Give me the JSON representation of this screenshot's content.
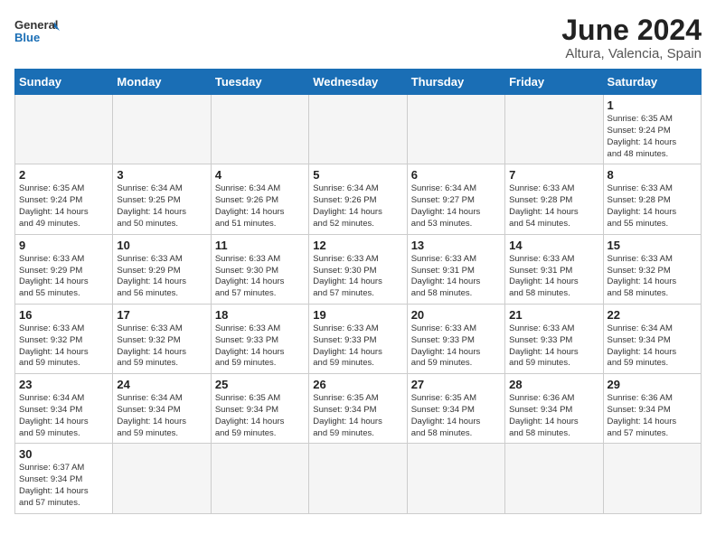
{
  "header": {
    "logo_general": "General",
    "logo_blue": "Blue",
    "month_title": "June 2024",
    "location": "Altura, Valencia, Spain"
  },
  "weekdays": [
    "Sunday",
    "Monday",
    "Tuesday",
    "Wednesday",
    "Thursday",
    "Friday",
    "Saturday"
  ],
  "days": {
    "d1": {
      "num": "1",
      "info": "Sunrise: 6:35 AM\nSunset: 9:24 PM\nDaylight: 14 hours\nand 48 minutes."
    },
    "d2": {
      "num": "2",
      "info": "Sunrise: 6:35 AM\nSunset: 9:24 PM\nDaylight: 14 hours\nand 49 minutes."
    },
    "d3": {
      "num": "3",
      "info": "Sunrise: 6:34 AM\nSunset: 9:25 PM\nDaylight: 14 hours\nand 50 minutes."
    },
    "d4": {
      "num": "4",
      "info": "Sunrise: 6:34 AM\nSunset: 9:26 PM\nDaylight: 14 hours\nand 51 minutes."
    },
    "d5": {
      "num": "5",
      "info": "Sunrise: 6:34 AM\nSunset: 9:26 PM\nDaylight: 14 hours\nand 52 minutes."
    },
    "d6": {
      "num": "6",
      "info": "Sunrise: 6:34 AM\nSunset: 9:27 PM\nDaylight: 14 hours\nand 53 minutes."
    },
    "d7": {
      "num": "7",
      "info": "Sunrise: 6:33 AM\nSunset: 9:28 PM\nDaylight: 14 hours\nand 54 minutes."
    },
    "d8": {
      "num": "8",
      "info": "Sunrise: 6:33 AM\nSunset: 9:28 PM\nDaylight: 14 hours\nand 55 minutes."
    },
    "d9": {
      "num": "9",
      "info": "Sunrise: 6:33 AM\nSunset: 9:29 PM\nDaylight: 14 hours\nand 55 minutes."
    },
    "d10": {
      "num": "10",
      "info": "Sunrise: 6:33 AM\nSunset: 9:29 PM\nDaylight: 14 hours\nand 56 minutes."
    },
    "d11": {
      "num": "11",
      "info": "Sunrise: 6:33 AM\nSunset: 9:30 PM\nDaylight: 14 hours\nand 57 minutes."
    },
    "d12": {
      "num": "12",
      "info": "Sunrise: 6:33 AM\nSunset: 9:30 PM\nDaylight: 14 hours\nand 57 minutes."
    },
    "d13": {
      "num": "13",
      "info": "Sunrise: 6:33 AM\nSunset: 9:31 PM\nDaylight: 14 hours\nand 58 minutes."
    },
    "d14": {
      "num": "14",
      "info": "Sunrise: 6:33 AM\nSunset: 9:31 PM\nDaylight: 14 hours\nand 58 minutes."
    },
    "d15": {
      "num": "15",
      "info": "Sunrise: 6:33 AM\nSunset: 9:32 PM\nDaylight: 14 hours\nand 58 minutes."
    },
    "d16": {
      "num": "16",
      "info": "Sunrise: 6:33 AM\nSunset: 9:32 PM\nDaylight: 14 hours\nand 59 minutes."
    },
    "d17": {
      "num": "17",
      "info": "Sunrise: 6:33 AM\nSunset: 9:32 PM\nDaylight: 14 hours\nand 59 minutes."
    },
    "d18": {
      "num": "18",
      "info": "Sunrise: 6:33 AM\nSunset: 9:33 PM\nDaylight: 14 hours\nand 59 minutes."
    },
    "d19": {
      "num": "19",
      "info": "Sunrise: 6:33 AM\nSunset: 9:33 PM\nDaylight: 14 hours\nand 59 minutes."
    },
    "d20": {
      "num": "20",
      "info": "Sunrise: 6:33 AM\nSunset: 9:33 PM\nDaylight: 14 hours\nand 59 minutes."
    },
    "d21": {
      "num": "21",
      "info": "Sunrise: 6:33 AM\nSunset: 9:33 PM\nDaylight: 14 hours\nand 59 minutes."
    },
    "d22": {
      "num": "22",
      "info": "Sunrise: 6:34 AM\nSunset: 9:34 PM\nDaylight: 14 hours\nand 59 minutes."
    },
    "d23": {
      "num": "23",
      "info": "Sunrise: 6:34 AM\nSunset: 9:34 PM\nDaylight: 14 hours\nand 59 minutes."
    },
    "d24": {
      "num": "24",
      "info": "Sunrise: 6:34 AM\nSunset: 9:34 PM\nDaylight: 14 hours\nand 59 minutes."
    },
    "d25": {
      "num": "25",
      "info": "Sunrise: 6:35 AM\nSunset: 9:34 PM\nDaylight: 14 hours\nand 59 minutes."
    },
    "d26": {
      "num": "26",
      "info": "Sunrise: 6:35 AM\nSunset: 9:34 PM\nDaylight: 14 hours\nand 59 minutes."
    },
    "d27": {
      "num": "27",
      "info": "Sunrise: 6:35 AM\nSunset: 9:34 PM\nDaylight: 14 hours\nand 58 minutes."
    },
    "d28": {
      "num": "28",
      "info": "Sunrise: 6:36 AM\nSunset: 9:34 PM\nDaylight: 14 hours\nand 58 minutes."
    },
    "d29": {
      "num": "29",
      "info": "Sunrise: 6:36 AM\nSunset: 9:34 PM\nDaylight: 14 hours\nand 57 minutes."
    },
    "d30": {
      "num": "30",
      "info": "Sunrise: 6:37 AM\nSunset: 9:34 PM\nDaylight: 14 hours\nand 57 minutes."
    }
  }
}
